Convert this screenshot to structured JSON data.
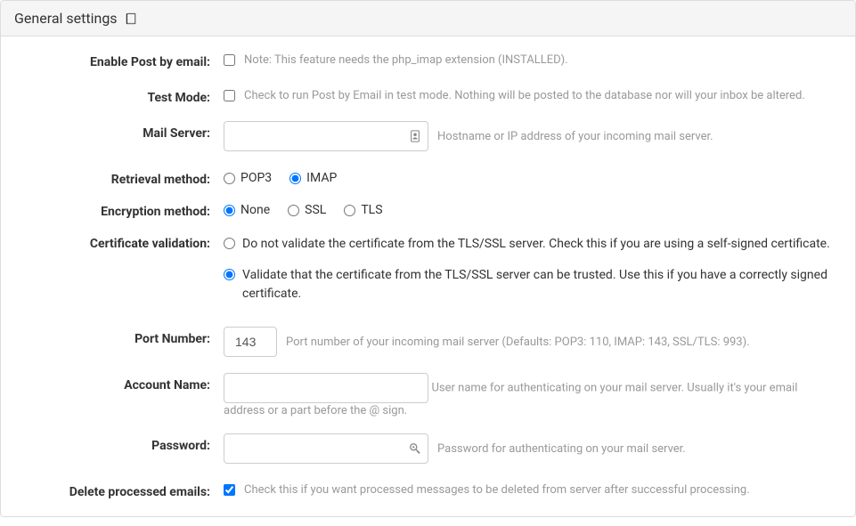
{
  "panel": {
    "title": "General settings"
  },
  "fields": {
    "enable": {
      "label": "Enable Post by email:",
      "note": "Note: This feature needs the php_imap extension (INSTALLED).",
      "checked": false
    },
    "testMode": {
      "label": "Test Mode:",
      "note": "Check to run Post by Email in test mode. Nothing will be posted to the database nor will your inbox be altered.",
      "checked": false
    },
    "mailServer": {
      "label": "Mail Server:",
      "value": "",
      "help": "Hostname or IP address of your incoming mail server."
    },
    "retrieval": {
      "label": "Retrieval method:",
      "options": {
        "pop3": "POP3",
        "imap": "IMAP"
      },
      "selected": "imap"
    },
    "encryption": {
      "label": "Encryption method:",
      "options": {
        "none": "None",
        "ssl": "SSL",
        "tls": "TLS"
      },
      "selected": "none"
    },
    "cert": {
      "label": "Certificate validation:",
      "opt1": "Do not validate the certificate from the TLS/SSL server. Check this if you are using a self-signed certificate.",
      "opt2": "Validate that the certificate from the TLS/SSL server can be trusted. Use this if you have a correctly signed certificate.",
      "selected": "validate"
    },
    "port": {
      "label": "Port Number:",
      "value": "143",
      "help": "Port number of your incoming mail server (Defaults: POP3: 110, IMAP: 143, SSL/TLS: 993)."
    },
    "account": {
      "label": "Account Name:",
      "value": "",
      "help": "User name for authenticating on your mail server. Usually it's your email address or a part before the @ sign."
    },
    "password": {
      "label": "Password:",
      "value": "",
      "help": "Password for authenticating on your mail server."
    },
    "deleteProcessed": {
      "label": "Delete processed emails:",
      "note": "Check this if you want processed messages to be deleted from server after successful processing.",
      "checked": true
    }
  }
}
